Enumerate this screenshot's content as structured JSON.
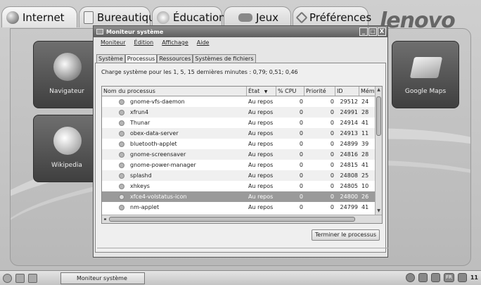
{
  "launcher": {
    "tabs": [
      {
        "label": "Internet",
        "icon": "globe-icon",
        "active": true
      },
      {
        "label": "Bureautique",
        "icon": "document-icon",
        "active": false
      },
      {
        "label": "Éducation",
        "icon": "lightbulb-icon",
        "active": false
      },
      {
        "label": "Jeux",
        "icon": "gamepad-icon",
        "active": false
      },
      {
        "label": "Préférences",
        "icon": "wrench-icon",
        "active": false
      }
    ],
    "brand": "lenovo",
    "tiles": [
      {
        "label": "Navigateur",
        "icon": "browser-globe-icon"
      },
      {
        "label": "Wikipedia",
        "icon": "wikipedia-globe-icon"
      },
      {
        "label": "Google Maps",
        "icon": "map-icon"
      }
    ]
  },
  "window": {
    "title": "Moniteur système",
    "controls": [
      "_",
      "□",
      "X"
    ],
    "menu": [
      "Moniteur",
      "Édition",
      "Affichage",
      "Aide"
    ],
    "tabs": [
      {
        "label": "Système",
        "active": false
      },
      {
        "label": "Processus",
        "active": true
      },
      {
        "label": "Ressources",
        "active": false
      },
      {
        "label": "Systèmes de fichiers",
        "active": false
      }
    ],
    "load_text": "Charge système pour les 1, 5, 15 dernières minutes : 0,79; 0,51; 0,46",
    "columns": {
      "name": "Nom du processus",
      "state": "État",
      "cpu": "% CPU",
      "priority": "Priorité",
      "id": "ID",
      "mem": "Mém"
    },
    "processes": [
      {
        "name": "gnome-vfs-daemon",
        "state": "Au repos",
        "cpu": "0",
        "priority": "0",
        "id": "29512",
        "mem": "24"
      },
      {
        "name": "xfrun4",
        "state": "Au repos",
        "cpu": "0",
        "priority": "0",
        "id": "24991",
        "mem": "28"
      },
      {
        "name": "Thunar",
        "state": "Au repos",
        "cpu": "0",
        "priority": "0",
        "id": "24914",
        "mem": "41"
      },
      {
        "name": "obex-data-server",
        "state": "Au repos",
        "cpu": "0",
        "priority": "0",
        "id": "24913",
        "mem": "11"
      },
      {
        "name": "bluetooth-applet",
        "state": "Au repos",
        "cpu": "0",
        "priority": "0",
        "id": "24899",
        "mem": "39"
      },
      {
        "name": "gnome-screensaver",
        "state": "Au repos",
        "cpu": "0",
        "priority": "0",
        "id": "24816",
        "mem": "28"
      },
      {
        "name": "gnome-power-manager",
        "state": "Au repos",
        "cpu": "0",
        "priority": "0",
        "id": "24815",
        "mem": "41"
      },
      {
        "name": "splashd",
        "state": "Au repos",
        "cpu": "0",
        "priority": "0",
        "id": "24808",
        "mem": "25"
      },
      {
        "name": "xhkeys",
        "state": "Au repos",
        "cpu": "0",
        "priority": "0",
        "id": "24805",
        "mem": "10"
      },
      {
        "name": "xfce4-volstatus-icon",
        "state": "Au repos",
        "cpu": "0",
        "priority": "0",
        "id": "24800",
        "mem": "26",
        "selected": true
      },
      {
        "name": "nm-applet",
        "state": "Au repos",
        "cpu": "0",
        "priority": "0",
        "id": "24799",
        "mem": "41"
      }
    ],
    "end_button": "Terminer le processus"
  },
  "taskbar": {
    "task_label": "Moniteur système",
    "clock": "11",
    "tray_text": "FR"
  },
  "colors": {
    "selection": "#9a9a9a",
    "titlebar": "#6e6e6e"
  }
}
